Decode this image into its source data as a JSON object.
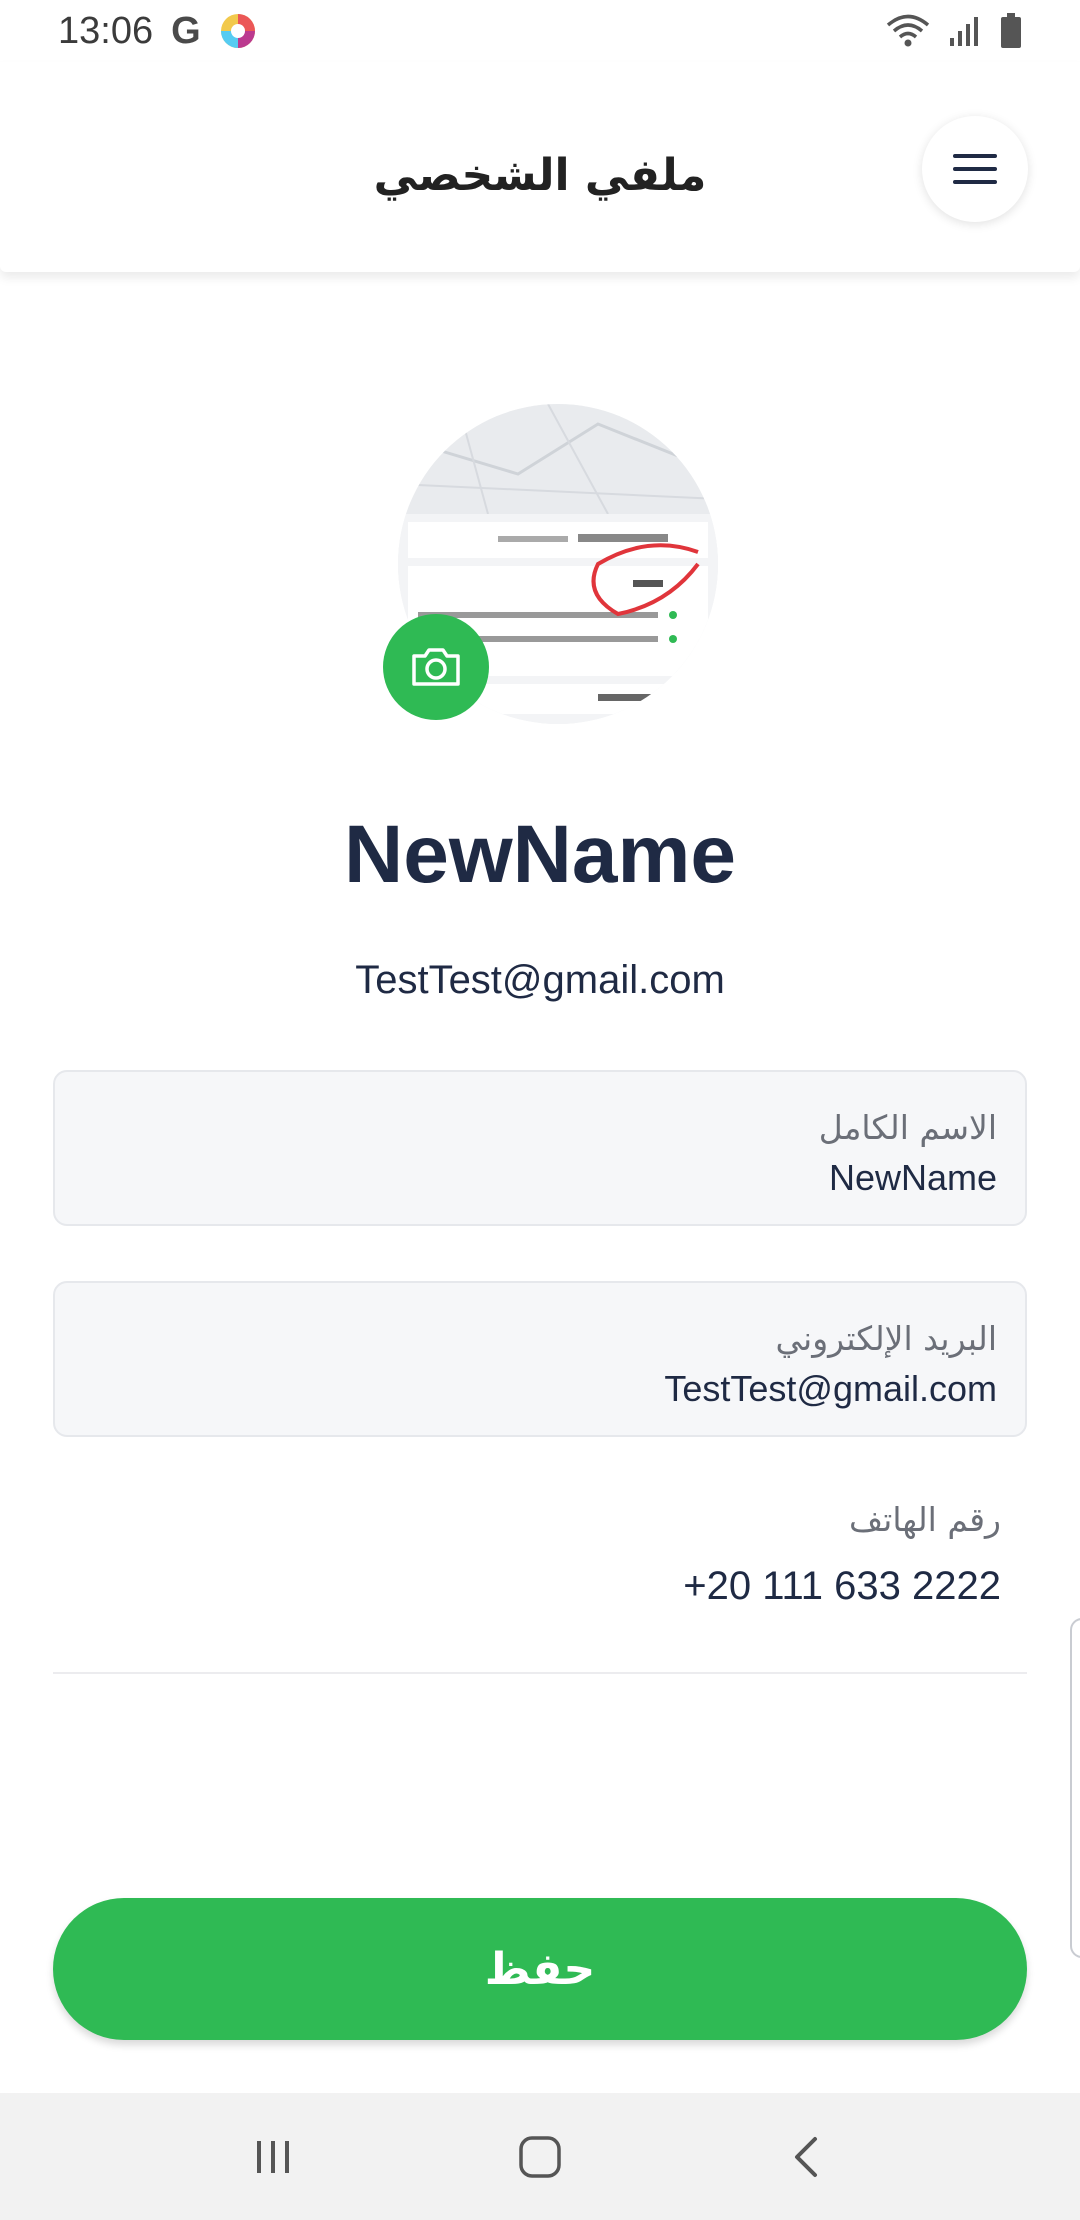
{
  "status_bar": {
    "time": "13:06",
    "google_icon_letter": "G",
    "icons": [
      "google-icon",
      "app-icon",
      "wifi-icon",
      "signal-icon",
      "battery-icon"
    ]
  },
  "header": {
    "title": "ملفي الشخصي",
    "menu_icon": "hamburger-menu-icon"
  },
  "profile": {
    "avatar_icon": "profile-photo",
    "camera_icon": "camera-icon",
    "name": "NewName",
    "email": "TestTest@gmail.com"
  },
  "form": {
    "full_name": {
      "label": "الاسم الكامل",
      "value": "NewName"
    },
    "email": {
      "label": "البريد الإلكتروني",
      "value": "TestTest@gmail.com"
    },
    "phone": {
      "label": "رقم الهاتف",
      "value": "+20 111 633 2222"
    }
  },
  "save_button": {
    "label": "حفظ"
  },
  "nav_bar": {
    "icons": [
      "recents-icon",
      "home-icon",
      "back-icon"
    ]
  },
  "colors": {
    "accent": "#2fba54",
    "text_dark": "#1f2a44",
    "field_bg": "#f6f7f9",
    "nav_bg": "#f2f2f2"
  }
}
